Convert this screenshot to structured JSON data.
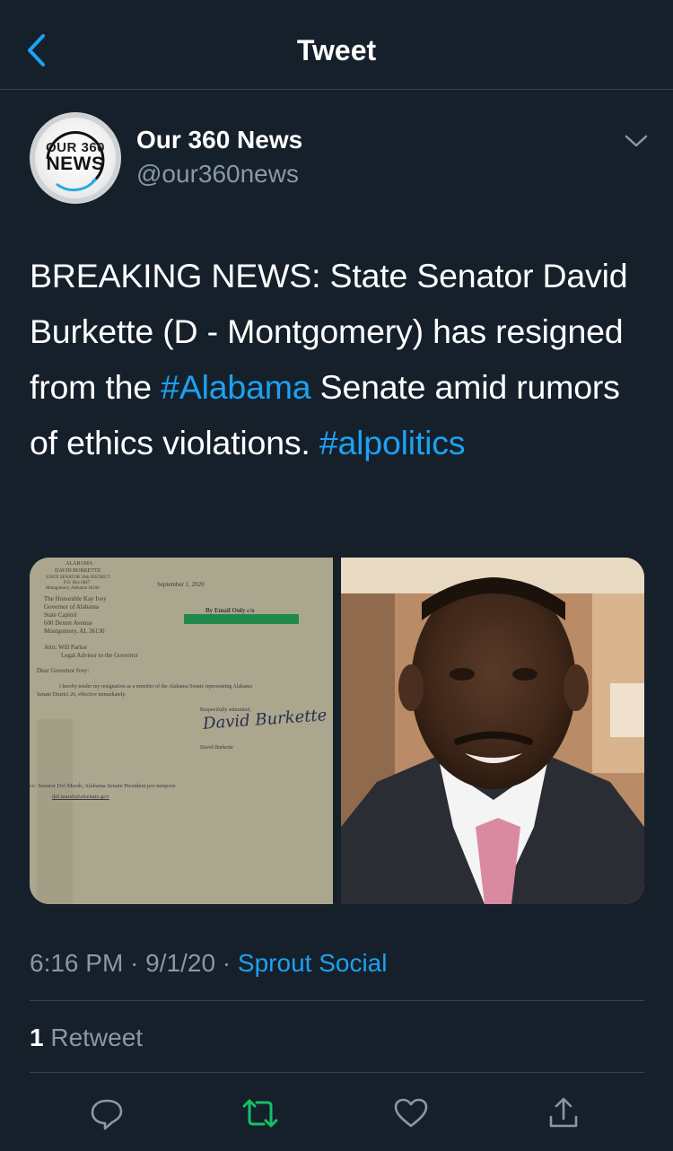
{
  "header": {
    "title": "Tweet"
  },
  "author": {
    "display_name": "Our 360 News",
    "handle": "@our360news",
    "avatar_line1": "OUR 360",
    "avatar_line2": "NEWS"
  },
  "tweet": {
    "text_part1": "BREAKING NEWS: State Senator David Burkette (D - Montgomery) has resigned from the ",
    "hashtag1": "#Alabama",
    "text_part2": " Senate amid rumors of ethics violations. ",
    "hashtag2": "#alpolitics"
  },
  "media": {
    "letter": {
      "state": "ALABAMA",
      "sender_name": "DAVID BURKETTE",
      "sender_title": "STATE SENATOR 26th DISTRICT",
      "sender_box": "P.O. Box 6847",
      "sender_city": "Montgomery, Alabama 36106",
      "date": "September 1, 2020",
      "addressee_1": "The Honorable Kay Ivey",
      "addressee_2": "Governor of Alabama",
      "addressee_3": "State Capitol",
      "addressee_4": "600 Dexter Avenue",
      "addressee_5": "Montgomery, AL 36130",
      "email_note": "By Email Only c/o",
      "attn_1": "Attn:  Will Parker",
      "attn_2": "Legal Advisor to the Governor",
      "salutation": "Dear Governor Ivey:",
      "body_1": "I hereby tender my resignation as a member of the Alabama Senate representing Alabama",
      "body_2": "Senate District 26, effective immediately.",
      "closing": "Respectfully submitted,",
      "signature": "David Burkette",
      "signer": "David Burkette",
      "cc_1": "cc:   Senator Del Marsh, Alabama Senate President pro tempore",
      "cc_2": "del.marsh@alsenate.gov"
    }
  },
  "meta": {
    "time": "6:16 PM",
    "separator": " · ",
    "date": "9/1/20",
    "source": "Sprout Social"
  },
  "stats": {
    "retweet_count": "1",
    "retweet_label": "Retweet"
  },
  "actions": {
    "reply_icon": "reply-icon",
    "retweet_icon": "retweet-icon",
    "like_icon": "heart-icon",
    "share_icon": "share-icon"
  },
  "colors": {
    "background": "#15202b",
    "accent": "#1da1f2",
    "secondary_text": "#8899a6",
    "divider": "#38444d",
    "retweet_green": "#17bf63"
  }
}
